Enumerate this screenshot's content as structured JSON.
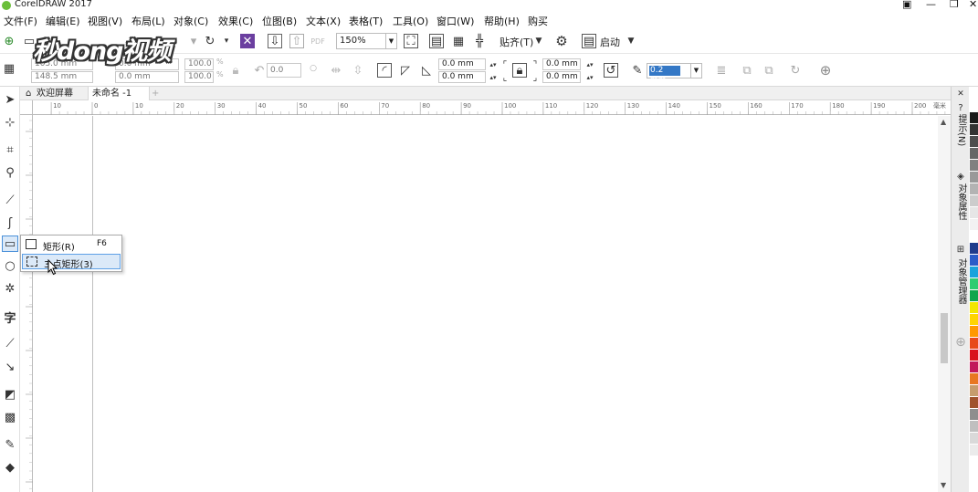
{
  "window": {
    "title": "CorelDRAW 2017"
  },
  "menu": [
    "文件(F)",
    "编辑(E)",
    "视图(V)",
    "布局(L)",
    "对象(C)",
    "效果(C)",
    "位图(B)",
    "文本(X)",
    "表格(T)",
    "工具(O)",
    "窗口(W)",
    "帮助(H)",
    "购买"
  ],
  "watermark": "秒dong视频",
  "toolbar": {
    "zoom": "150%",
    "snap_label": "贴齐(T)",
    "launch_label": "启动"
  },
  "property_bar": {
    "x_pos": "105.0 mm",
    "y_pos": "148.5 mm",
    "width": "0.0 mm",
    "height": "0.0 mm",
    "scale_x": "100.0",
    "scale_y": "100.0",
    "scale_unit": "%",
    "rotation": "0.0",
    "corner_tl": "0.0 mm",
    "corner_bl": "0.0 mm",
    "corner_tr": "0.0 mm",
    "corner_br": "0.0 mm",
    "outline_width": "0.2 mm"
  },
  "tabs": {
    "welcome": "欢迎屏幕",
    "document": "未命名 -1",
    "add": "+"
  },
  "ruler": {
    "h_ticks": [
      "10",
      "0",
      "10",
      "20",
      "30",
      "40",
      "50",
      "60",
      "70",
      "80",
      "90",
      "100",
      "110",
      "120",
      "130",
      "140",
      "150",
      "160",
      "170",
      "180",
      "190",
      "200"
    ],
    "unit": "毫米"
  },
  "flyout": {
    "items": [
      {
        "label": "矩形(R)",
        "shortcut": "F6"
      },
      {
        "label": "3 点矩形(3)",
        "shortcut": ""
      }
    ]
  },
  "docker": {
    "tab1": "提示(N)",
    "tab2": "对象属性",
    "tab3": "对象管理器"
  },
  "palette": [
    "#ffffff",
    "#1a1a1a",
    "#333333",
    "#4d4d4d",
    "#666666",
    "#808080",
    "#999999",
    "#b3b3b3",
    "#cccccc",
    "#e6e6e6",
    "#f2f2f2",
    "#ffffff",
    "#1f3b8c",
    "#2a5cc8",
    "#1aa3dc",
    "#2ecc71",
    "#10a54c",
    "#f2e600",
    "#ffd400",
    "#ff9900",
    "#e84a1b",
    "#d9121c",
    "#c2185b",
    "#e87722",
    "#c69c6d",
    "#a0522d",
    "#8e8e8e",
    "#bfbfbf",
    "#d9d9d9",
    "#ebebeb"
  ]
}
